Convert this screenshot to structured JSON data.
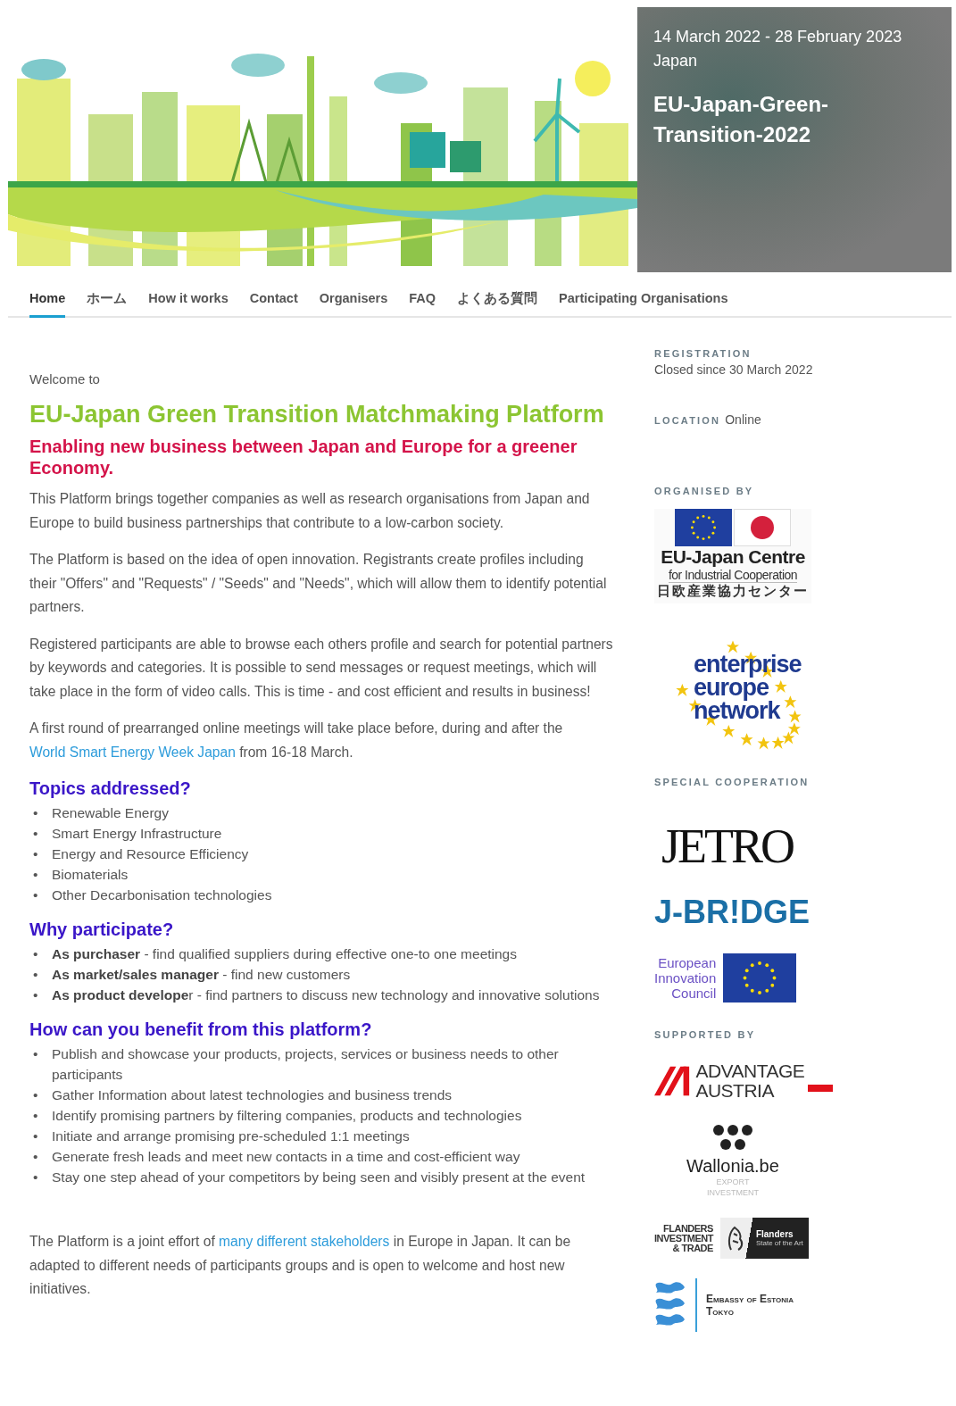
{
  "banner": {
    "dates": "14 March 2022 - 28 February 2023",
    "place": "Japan",
    "title": "EU-Japan-Green-Transition-2022"
  },
  "nav": [
    {
      "label": "Home",
      "selected": true
    },
    {
      "label": "ホーム",
      "selected": false
    },
    {
      "label": "How it works",
      "selected": false
    },
    {
      "label": "Contact",
      "selected": false
    },
    {
      "label": "Organisers",
      "selected": false
    },
    {
      "label": "FAQ",
      "selected": false
    },
    {
      "label": "よくある質問",
      "selected": false
    },
    {
      "label": "Participating Organisations",
      "selected": false
    }
  ],
  "main": {
    "welcome": "Welcome to",
    "title": "EU-Japan Green Transition Matchmaking Platform",
    "subtitle": "Enabling new business between Japan and Europe for a greener Economy.",
    "intro": [
      {
        "parts": [
          {
            "kind": "text",
            "text": "This Platform brings together companies as well as research organisations from Japan and Europe to build business partnerships that contribute to a low-carbon society."
          }
        ]
      },
      {
        "parts": [
          {
            "kind": "text",
            "text": "The Platform is based on the idea of open innovation. Registrants create profiles including their \"Offers\" and \"Requests\" / \"Seeds\" and \"Needs\", which will allow them to identify potential  partners."
          }
        ]
      },
      {
        "parts": [
          {
            "kind": "text",
            "text": "Registered participants are able to browse each others profile and search for potential partners by keywords and categories. It is possible to send messages or request meetings, which will take place in the form of video calls. This is time - and cost efficient and results in business!"
          }
        ]
      },
      {
        "parts": [
          {
            "kind": "text",
            "text": "A first round of prearranged online meetings will take place before, during and after the "
          },
          {
            "kind": "link",
            "text": "World Smart Energy Week Japan"
          },
          {
            "kind": "text",
            "text": " from 16-18 March."
          }
        ]
      }
    ],
    "sections": [
      {
        "heading": "Topics addressed?",
        "marker": "•",
        "items": [
          "Renewable Energy",
          "Smart Energy Infrastructure",
          "Energy and Resource Efficiency",
          "Biomaterials",
          "Other Decarbonisation technologies"
        ]
      },
      {
        "heading": "Why participate?",
        "marker": "•",
        "items": [
          "**As purchaser** - find qualified suppliers during effective one-to one meetings",
          "**As market/sales manager** - find new customers",
          "**As product develope**r - find partners to discuss new technology and innovative solutions"
        ]
      },
      {
        "heading": "How can you benefit from this platform?",
        "marker": "•",
        "items": [
          "Publish and showcase your products, projects, services or business needs to other participants",
          "Gather Information about latest technologies and business trends",
          "Identify promising partners by filtering companies, products and technologies",
          "Initiate and arrange promising pre-scheduled 1:1 meetings",
          "Generate fresh leads and meet new contacts in a time and cost-efficient way",
          "Stay one step ahead of your competitors by being seen and visibly present at the event"
        ]
      }
    ],
    "closing": {
      "parts": [
        {
          "kind": "text",
          "text": "The Platform is a joint effort of "
        },
        {
          "kind": "link",
          "text": "many different stakeholders"
        },
        {
          "kind": "text",
          "text": " in Europe in Japan. It can be adapted to different needs of participants groups and is open to welcome and host new initiatives."
        }
      ]
    }
  },
  "sidebar": [
    {
      "kind": "label",
      "text": "REGISTRATION"
    },
    {
      "kind": "value",
      "text": "Closed since 30 March 2022"
    },
    {
      "kind": "inline",
      "label": "LOCATION",
      "text": "Online"
    },
    {
      "kind": "label",
      "text": "ORGANISED BY"
    },
    {
      "kind": "eu-japan",
      "lines": [
        "EU-Japan Centre",
        "for Industrial Cooperation",
        "日欧産業協力センター"
      ]
    },
    {
      "kind": "een",
      "lines": [
        "enterprise",
        "europe",
        "network"
      ]
    },
    {
      "kind": "label",
      "text": "SPECIAL COOPERATION"
    },
    {
      "kind": "jetro",
      "lines": [
        "JETRO"
      ]
    },
    {
      "kind": "jbridge",
      "lines": [
        "J-BR!DGE"
      ]
    },
    {
      "kind": "eic",
      "lines": [
        "European",
        "Innovation",
        "Council"
      ]
    },
    {
      "kind": "label",
      "text": "SUPPORTED BY"
    },
    {
      "kind": "austria",
      "lines": [
        "ADVANTAGE",
        "AUSTRIA"
      ]
    },
    {
      "kind": "wallonia",
      "lines": [
        "Wallonia.be",
        "EXPORT",
        "INVESTMENT"
      ]
    },
    {
      "kind": "flanders",
      "lines": [
        "FLANDERS",
        "INVESTMENT",
        "& TRADE",
        "Flanders",
        "State of the Art"
      ]
    },
    {
      "kind": "estonia",
      "lines": [
        "Embassy of Estonia",
        "Tokyo"
      ]
    }
  ]
}
